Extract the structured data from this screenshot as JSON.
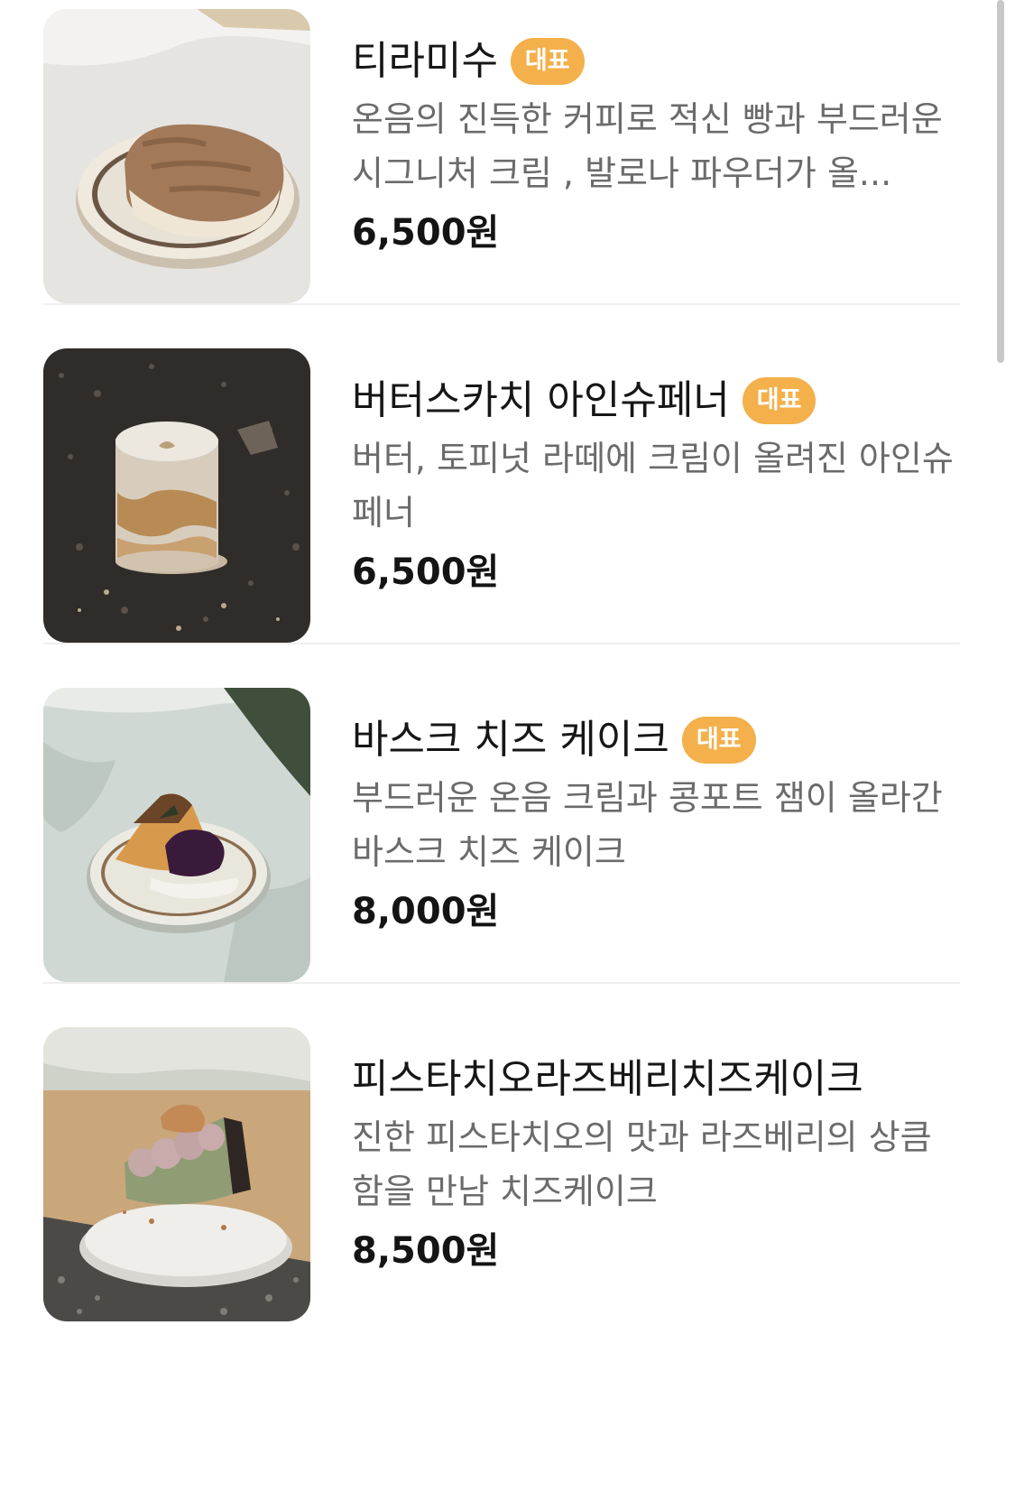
{
  "menu": {
    "items": [
      {
        "name": "티라미수",
        "badge": "대표",
        "description": "온음의 진득한 커피로 적신 빵과 부드러운 시그니처 크림 , 발로나 파우더가 올...",
        "price": "6,500원",
        "image_icon": "tiramisu-photo"
      },
      {
        "name": "버터스카치 아인슈페너",
        "badge": "대표",
        "description": "버터, 토피넛 라떼에 크림이 올려진 아인슈페너",
        "price": "6,500원",
        "image_icon": "einspanner-photo"
      },
      {
        "name": "바스크 치즈 케이크",
        "badge": "대표",
        "description": "부드러운 온음 크림과 콩포트 잼이 올라간 바스크 치즈 케이크",
        "price": "8,000원",
        "image_icon": "basque-cheesecake-photo"
      },
      {
        "name": "피스타치오라즈베리치즈케이크",
        "badge": "",
        "description": "진한 피스타치오의 맛과 라즈베리의 상큼함을 만남 치즈케이크",
        "price": "8,500원",
        "image_icon": "pistachio-cheesecake-photo"
      }
    ]
  },
  "colors": {
    "badge": "#f3b04b",
    "description": "#6b6b6b",
    "divider": "#efefef"
  }
}
